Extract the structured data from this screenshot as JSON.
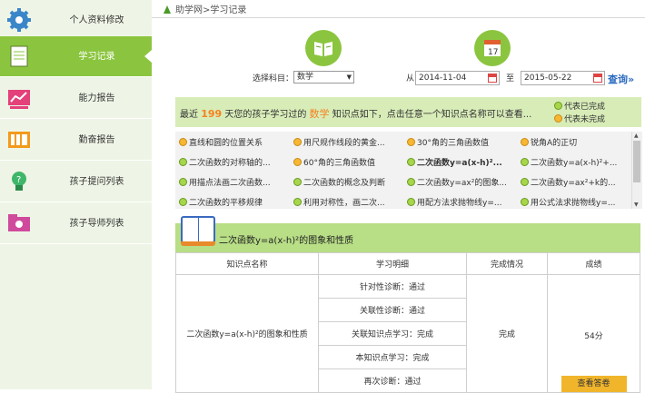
{
  "breadcrumb": "助学网>学习记录",
  "sidebar": {
    "items": [
      {
        "label": "个人资料修改",
        "icon": "gear-icon",
        "color": "#3a86c8"
      },
      {
        "label": "学习记录",
        "icon": "notebook-icon",
        "color": "#8bc53f",
        "active": true
      },
      {
        "label": "能力报告",
        "icon": "chart-board-icon",
        "color": "#e4407a"
      },
      {
        "label": "勤奋报告",
        "icon": "bookshelf-icon",
        "color": "#f39a1c"
      },
      {
        "label": "孩子提问列表",
        "icon": "lightbulb-icon",
        "color": "#3fb66a"
      },
      {
        "label": "孩子导师列表",
        "icon": "folder-icon",
        "color": "#d04a9c"
      }
    ]
  },
  "filter": {
    "subject_label": "选择科目：",
    "subject_value": "数学",
    "from_label": "从",
    "from_date": "2014-11-04",
    "to_label": "至",
    "to_date": "2015-05-22",
    "query_label": "查询"
  },
  "summary": {
    "prefix": "最近",
    "days": "199",
    "middle": "天您的孩子学习过的",
    "subject": "数学",
    "suffix": "知识点如下，点击任意一个知识点名称可以查看...",
    "legend_done": "代表已完成",
    "legend_undone": "代表未完成"
  },
  "knowledge_points": [
    {
      "label": "直线和圆的位置关系",
      "status": "undone"
    },
    {
      "label": "用尺规作线段的黄金...",
      "status": "undone"
    },
    {
      "label": "30°角的三角函数值",
      "status": "undone"
    },
    {
      "label": "锐角A的正切",
      "status": "undone"
    },
    {
      "label": "二次函数的对称轴的...",
      "status": "done"
    },
    {
      "label": "60°角的三角函数值",
      "status": "undone"
    },
    {
      "label": "二次函数y=a(x-h)²...",
      "status": "done",
      "bold": true
    },
    {
      "label": "二次函数y=a(x-h)²+...",
      "status": "done"
    },
    {
      "label": "用描点法画二次函数...",
      "status": "done"
    },
    {
      "label": "二次函数的概念及判断",
      "status": "done"
    },
    {
      "label": "二次函数y=ax²的图象...",
      "status": "done"
    },
    {
      "label": "二次函数y=ax²+k的...",
      "status": "done"
    },
    {
      "label": "二次函数的平移规律",
      "status": "done"
    },
    {
      "label": "利用对称性，画二次...",
      "status": "done"
    },
    {
      "label": "用配方法求抛物线y=...",
      "status": "done"
    },
    {
      "label": "用公式法求抛物线y=...",
      "status": "done"
    }
  ],
  "detail": {
    "title": "二次函数y=a(x-h)²的图象和性质",
    "columns": [
      "知识点名称",
      "学习明细",
      "完成情况",
      "成绩"
    ],
    "point_name": "二次函数y=a(x-h)²的图象和性质",
    "steps": [
      "针对性诊断：通过",
      "关联性诊断：通过",
      "关联知识点学习：完成",
      "本知识点学习：完成",
      "再次诊断：通过"
    ],
    "status": "完成",
    "score": "54分",
    "view_answer_label": "查看答卷"
  }
}
